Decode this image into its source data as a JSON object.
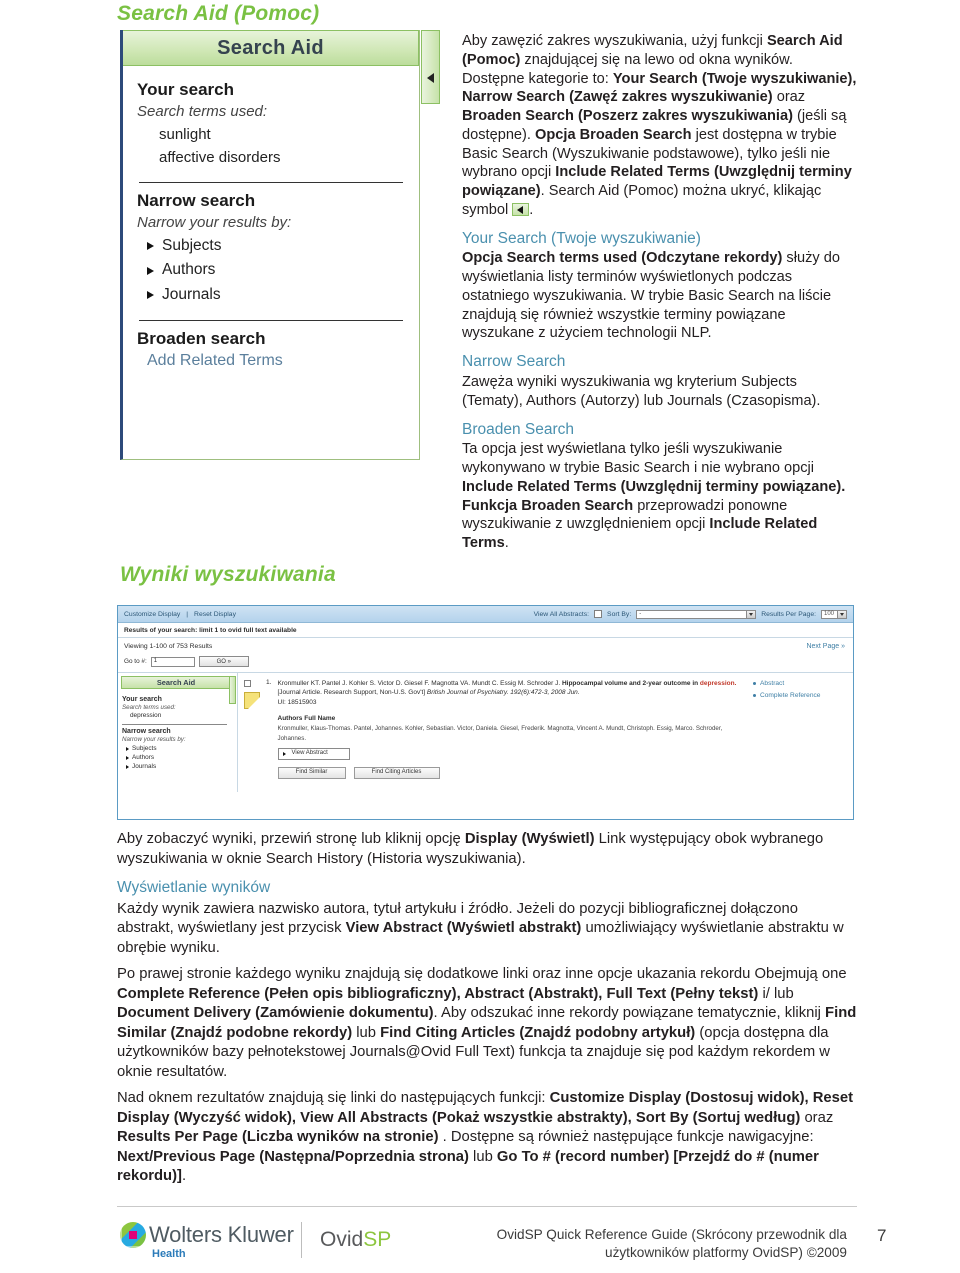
{
  "section": {
    "title": "Search Aid (Pomoc)",
    "results_caption": "Wyniki wyszukiwania"
  },
  "search_aid_screenshot": {
    "header": "Search Aid",
    "collapse_icon": "collapse-left-icon",
    "your_search": {
      "title": "Your search",
      "subtitle": "Search terms used:",
      "terms": [
        "sunlight",
        "affective disorders"
      ]
    },
    "narrow_search": {
      "title": "Narrow search",
      "subtitle": "Narrow your results by:",
      "items": [
        "Subjects",
        "Authors",
        "Journals"
      ]
    },
    "broaden_search": {
      "title": "Broaden search",
      "link": "Add Related Terms"
    }
  },
  "right_column": {
    "intro": {
      "p1_a": "Aby zawęzić zakres wyszukiwania, użyj funkcji ",
      "p1_b": "Search Aid (Pomoc)",
      "p1_c": " znajdującej się na lewo od okna wyników. Dostępne kategorie to: ",
      "p1_d": "Your Search (Twoje wyszukiwanie), Narrow Search (Zawęź zakres wyszukiwanie)",
      "p1_e": " oraz ",
      "p1_f": "Broaden Search (Poszerz zakres wyszukiwania)",
      "p1_g": " (jeśli są dostępne). ",
      "p1_h": "Opcja Broaden Search",
      "p1_i": " jest dostępna w trybie Basic Search (Wyszukiwanie podstawowe), tylko jeśli nie wybrano opcji ",
      "p1_j": "Include Related Terms (Uwzględnij terminy powiązane)",
      "p1_k": ". Search Aid (Pomoc) można ukryć, klikając symbol ",
      "p1_l": "."
    },
    "your_search": {
      "heading": "Your Search (Twoje wyszukiwanie)",
      "bold": "Opcja Search terms used (Odczytane rekordy)",
      "text": " służy do wyświetlania listy terminów  wyświetlonych podczas ostatniego wyszukiwania. W trybie Basic Search na liście znajdują się również wszystkie terminy powiązane wyszukane z użyciem technologii NLP."
    },
    "narrow_search": {
      "heading": "Narrow Search",
      "text": "Zawęża wyniki wyszukiwania wg kryterium Subjects (Tematy), Authors (Autorzy) lub Journals (Czasopisma)."
    },
    "broaden_search": {
      "heading": "Broaden Search",
      "t1": "Ta opcja jest wyświetlana tylko jeśli wyszukiwanie wykonywano w trybie Basic Search i nie wybrano opcji ",
      "t2": "Include Related Terms (Uwzględnij terminy powiązane)",
      "t3": ". ",
      "t4": "Funkcja Broaden Search",
      "t5": " przeprowadzi ponowne wyszukiwanie z uwzględnieniem opcji ",
      "t6": "Include Related Terms",
      "t7": "."
    }
  },
  "results_screenshot": {
    "toolbar": {
      "customize_display": "Customize Display",
      "separator": "|",
      "reset_display": "Reset Display",
      "view_all_abstracts_label": "View All Abstracts:",
      "sort_by_label": "Sort By:",
      "sort_by_value": "-",
      "results_per_page_label": "Results Per Page:",
      "results_per_page_value": "100"
    },
    "search_summary": "Results of your search: limit 1 to ovid full text available",
    "viewing": "Viewing 1-100 of 753 Results",
    "next_page": "Next Page »",
    "goto_label": "Go to #:",
    "goto_value": "1",
    "go_button": "GO »",
    "sidebar": {
      "header": "Search Aid",
      "your_search_title": "Your search",
      "your_search_sub": "Search terms used:",
      "your_search_term": "depression",
      "narrow_title": "Narrow search",
      "narrow_sub": "Narrow your results by:",
      "narrow_items": [
        "Subjects",
        "Authors",
        "Journals"
      ]
    },
    "record": {
      "number": "1.",
      "authors": "Kronmuller KT. Pantel J. Kohler S. Victor D. Giesel F. Magnotta VA. Mundt C. Essig M. Schroder J.",
      "title": "Hippocampal volume and 2-year outcome in",
      "highlight": "depression.",
      "pubtypes": " [Journal Article. Research Support, Non-U.S. Gov't] ",
      "source": "British Journal of Psychiatry.",
      "citation": " 192(6):472-3, 2008 Jun.",
      "ui": "UI: 18515903",
      "authors_full_label": "Authors Full Name",
      "authors_full": "Kronmuller, Klaus-Thomas. Pantel, Johannes. Kohler, Sebastian. Victor, Daniela. Giesel, Frederik. Magnotta, Vincent A. Mundt, Christoph. Essig, Marco. Schroder, Johannes.",
      "view_abstract": "View Abstract",
      "find_similar": "Find Similar",
      "find_citing": "Find Citing Articles",
      "links": [
        "Abstract",
        "Complete Reference"
      ]
    }
  },
  "body_text": {
    "p1_a": "Aby zobaczyć wyniki, przewiń stronę lub kliknij opcję ",
    "p1_b": "Display (Wyświetl)",
    "p1_c": " Link występujący obok wybranego wyszukiwania w oknie Search History (Historia wyszukiwania).",
    "h1": "Wyświetlanie wyników",
    "p2_a": "Każdy wynik zawiera nazwisko autora, tytuł artykułu i źródło. Jeżeli do pozycji bibliograficznej dołączono abstrakt, wyświetlany jest przycisk ",
    "p2_b": "View Abstract (Wyświetl abstrakt)",
    "p2_c": " umożliwiający wyświetlanie abstraktu w obrębie wyniku.",
    "p3_a": "Po prawej stronie każdego wyniku znajdują się dodatkowe linki oraz inne opcje  ukazania rekordu Obejmują one ",
    "p3_b": "Complete Reference (Pełen opis bibliograficzny), Abstract (Abstrakt), Full Text (Pełny tekst)",
    "p3_c": " i/ lub ",
    "p3_d": "Document Delivery (Zamówienie dokumentu)",
    "p3_e": ". Aby odszukać inne rekordy powiązane tematycznie, kliknij ",
    "p3_f": "Find Similar (Znajdź podobne rekordy)",
    "p3_g": " lub ",
    "p3_h": "Find Citing Articles (Znajdź podobny artykuł)",
    "p3_i": " (opcja dostępna dla użytkowników bazy pełnotekstowej Journals@Ovid Full Text) funkcja ta  znajduje się pod każdym rekordem w oknie resultatów.",
    "p4_a": "Nad oknem rezultatów znajdują się linki do następujących funkcji: ",
    "p4_b": "Customize Display (Dostosuj widok), Reset Display (Wyczyść widok), View All Abstracts (Pokaż wszystkie abstrakty), Sort By (Sortuj według)",
    "p4_c": " oraz ",
    "p4_d": "Results Per Page (Liczba wyników na stronie)",
    "p4_e": " . Dostępne są również następujące funkcje nawigacyjne: ",
    "p4_f": "Next/Previous Page (Następna/Poprzednia strona)",
    "p4_g": " lub ",
    "p4_h": "Go To # (record number) [Przejdź do # (numer rekordu)]",
    "p4_i": "."
  },
  "footer": {
    "brand": "Wolters Kluwer",
    "brand_sub": "Health",
    "product_ovid": "Ovid",
    "product_sp": "SP",
    "note_line1": "OvidSP Quick Reference Guide (Skrócony przewodnik dla",
    "note_line2": "użytkowników platformy OvidSP) ©2009",
    "page_number": "7"
  },
  "colors": {
    "green_heading": "#7ac143",
    "blue_heading": "#4a90ae",
    "aid_green_border": "#8cc063",
    "screenshot_blue": "#5b9bc4",
    "link_blue": "#3f7fa5",
    "highlight_red": "#c0392b"
  }
}
